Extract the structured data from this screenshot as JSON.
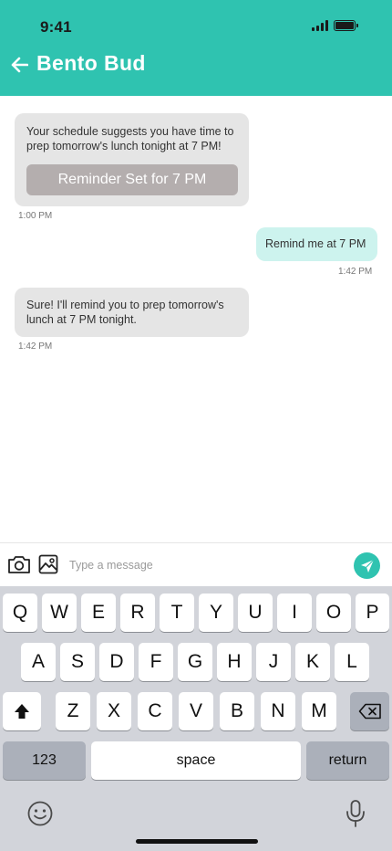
{
  "status_bar": {
    "time": "9:41"
  },
  "header": {
    "title": "Bento Bud"
  },
  "messages": [
    {
      "sender": "bot",
      "text": "Your schedule suggests you have time to prep tomorrow's lunch tonight at 7 PM!",
      "button_label": "Reminder Set for 7 PM",
      "time": "1:00 PM"
    },
    {
      "sender": "user",
      "text": "Remind me at 7 PM",
      "time": "1:42 PM"
    },
    {
      "sender": "bot",
      "text": "Sure! I'll remind you to prep tomorrow's lunch at 7 PM tonight.",
      "time": "1:42 PM"
    }
  ],
  "composer": {
    "placeholder": "Type a message",
    "value": ""
  },
  "keyboard": {
    "row1": [
      "Q",
      "W",
      "E",
      "R",
      "T",
      "Y",
      "U",
      "I",
      "O",
      "P"
    ],
    "row2": [
      "A",
      "S",
      "D",
      "F",
      "G",
      "H",
      "J",
      "K",
      "L"
    ],
    "row3": [
      "Z",
      "X",
      "C",
      "V",
      "B",
      "N",
      "M"
    ],
    "numbers_label": "123",
    "space_label": "space",
    "return_label": "return"
  },
  "colors": {
    "accent": "#2fc3b0",
    "bot_bubble": "#e5e5e5",
    "user_bubble": "#cdf3ee",
    "reminder_button": "#b4aeae"
  },
  "icons": {
    "back": "arrow-left-icon",
    "camera": "camera-icon",
    "image": "image-icon",
    "send": "send-icon",
    "shift": "shift-icon",
    "delete": "backspace-icon",
    "emoji": "emoji-icon",
    "mic": "microphone-icon",
    "signal": "signal-icon",
    "battery": "battery-icon"
  }
}
